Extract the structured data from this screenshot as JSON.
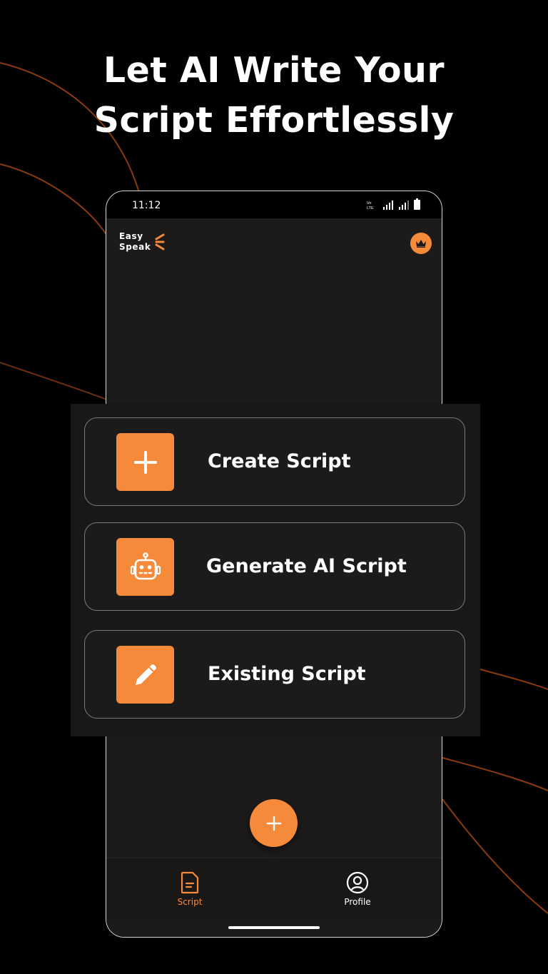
{
  "headline": {
    "line1": "Let AI Write Your",
    "line2": "Script Effortlessly"
  },
  "status_bar": {
    "time": "11:12",
    "icons": [
      "volte-icon",
      "signal-icon",
      "signal-icon",
      "battery-icon"
    ]
  },
  "app": {
    "logo_line1": "Easy",
    "logo_line2": "Speak",
    "premium_icon": "crown-icon"
  },
  "options": [
    {
      "label": "Create Script",
      "icon": "plus-icon"
    },
    {
      "label": "Generate AI Script",
      "icon": "robot-icon"
    },
    {
      "label": "Existing Script",
      "icon": "pencil-icon"
    }
  ],
  "fab": {
    "icon": "plus-icon"
  },
  "bottom_nav": [
    {
      "label": "Script",
      "icon": "document-icon",
      "active": true
    },
    {
      "label": "Profile",
      "icon": "user-circle-icon",
      "active": false
    }
  ],
  "colors": {
    "accent": "#f68a3b",
    "background": "#000000",
    "screen": "#1d1b1a",
    "curve": "#8a3a10"
  }
}
